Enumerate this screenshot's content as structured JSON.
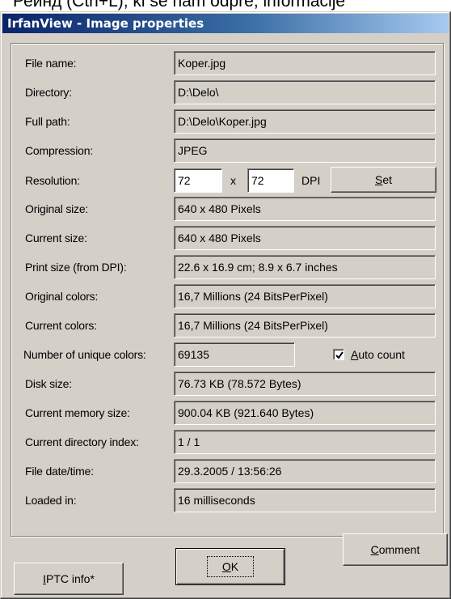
{
  "background_text": "Рейнд (Ctrl+L), ki se nam odpre, informacije",
  "window": {
    "title": "IrfanView - Image properties"
  },
  "fields": [
    {
      "label": "File name:",
      "value": "Koper.jpg"
    },
    {
      "label": "Directory:",
      "value": "D:\\Delo\\"
    },
    {
      "label": "Full path:",
      "value": "D:\\Delo\\Koper.jpg"
    },
    {
      "label": "Compression:",
      "value": "JPEG"
    },
    {
      "label": "Resolution:",
      "x_value": "72",
      "x_sep": "x",
      "y_value": "72",
      "unit": "DPI",
      "button": "Set"
    },
    {
      "label": "Original size:",
      "value": "640 x 480  Pixels"
    },
    {
      "label": "Current size:",
      "value": "640 x 480  Pixels"
    },
    {
      "label": "Print size (from DPI):",
      "value": "22.6 x 16.9 cm; 8.9 x 6.7 inches"
    },
    {
      "label": "Original colors:",
      "value": "16,7 Millions   (24 BitsPerPixel)"
    },
    {
      "label": "Current colors:",
      "value": "16,7 Millions   (24 BitsPerPixel)"
    },
    {
      "label": "Number of unique colors:",
      "value": "69135",
      "checkbox_label": "Auto count",
      "checkbox_checked": true
    },
    {
      "label": "Disk size:",
      "value": "76.73 KB (78.572 Bytes)"
    },
    {
      "label": "Current memory size:",
      "value": "900.04  KB (921.640 Bytes)"
    },
    {
      "label": "Current directory index:",
      "value": "1  /  1"
    },
    {
      "label": "File date/time:",
      "value": "29.3.2005 / 13:56:26"
    },
    {
      "label": "Loaded in:",
      "value": "16 milliseconds"
    }
  ],
  "buttons": {
    "iptc_prefix": "I",
    "iptc_rest": "PTC info*",
    "ok_accel": "O",
    "ok_rest": "K",
    "comment_accel": "C",
    "comment_rest": "omment",
    "set_accel": "S",
    "set_rest": "et"
  },
  "colors": {
    "face": "#d4d0c8",
    "title_start": "#0a246a",
    "title_end": "#a6caf0"
  }
}
